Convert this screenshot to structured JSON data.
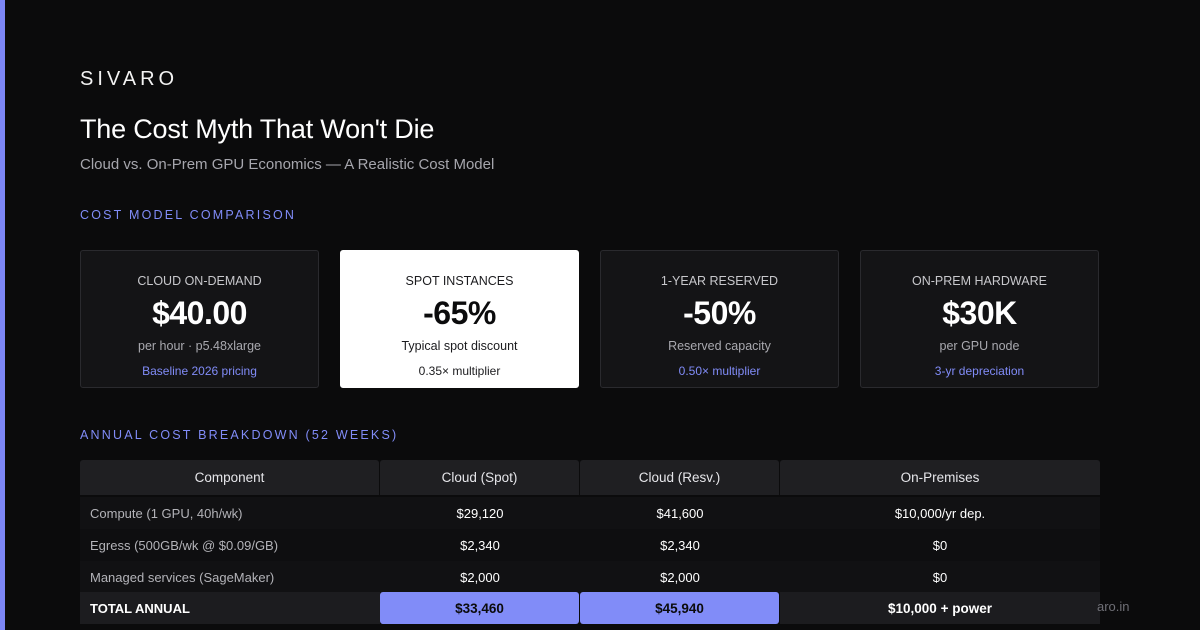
{
  "brand": "SIVARO",
  "title": "The Cost Myth That Won't Die",
  "subtitle": "Cloud vs. On-Prem GPU Economics — A Realistic Cost Model",
  "sections": {
    "comparison": "COST MODEL COMPARISON",
    "breakdown": "ANNUAL COST BREAKDOWN (52 WEEKS)"
  },
  "cards": [
    {
      "label": "CLOUD ON-DEMAND",
      "value": "$40.00",
      "desc": "per hour · p5.48xlarge",
      "note": "Baseline 2026 pricing"
    },
    {
      "label": "SPOT INSTANCES",
      "value": "-65%",
      "desc": "Typical spot discount",
      "note": "0.35× multiplier"
    },
    {
      "label": "1-YEAR RESERVED",
      "value": "-50%",
      "desc": "Reserved capacity",
      "note": "0.50× multiplier"
    },
    {
      "label": "ON-PREM HARDWARE",
      "value": "$30K",
      "desc": "per GPU node",
      "note": "3-yr depreciation"
    }
  ],
  "table": {
    "headers": [
      "Component",
      "Cloud (Spot)",
      "Cloud (Resv.)",
      "On-Premises"
    ],
    "rows": [
      [
        "Compute (1 GPU, 40h/wk)",
        "$29,120",
        "$41,600",
        "$10,000/yr dep."
      ],
      [
        "Egress (500GB/wk @ $0.09/GB)",
        "$2,340",
        "$2,340",
        "$0"
      ],
      [
        "Managed services (SageMaker)",
        "$2,000",
        "$2,000",
        "$0"
      ]
    ],
    "total": [
      "TOTAL ANNUAL",
      "$33,460",
      "$45,940",
      "$10,000 + power"
    ]
  },
  "footer": {
    "url": "aro.in"
  },
  "colors": {
    "accent": "#818cf8",
    "background": "#0b0b0c",
    "highlight_card": "#ffffff"
  }
}
